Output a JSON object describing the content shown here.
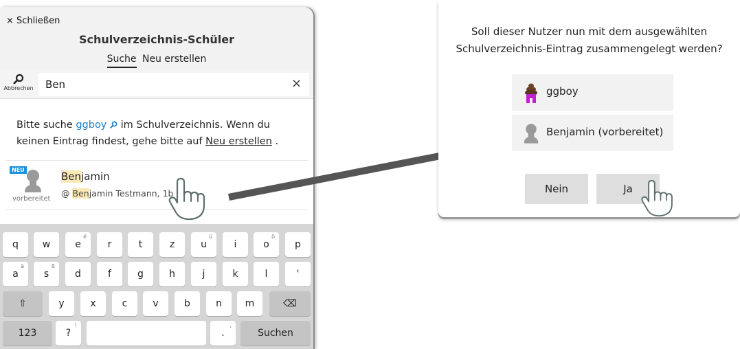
{
  "left_panel": {
    "close_label": "× Schließen",
    "title": "Schulverzeichnis-Schüler",
    "tabs": [
      {
        "label": "Suche",
        "active": true
      },
      {
        "label": "Neu erstellen",
        "active": false
      }
    ],
    "search": {
      "button_label": "Abbrechen",
      "value": "Ben",
      "clear_label": "×"
    },
    "info": {
      "part1": "Bitte suche ",
      "user": "ggboy",
      "part2": " im Schulverzeichnis. Wenn du keinen Eintrag findest, gehe bitte auf ",
      "link": "Neu erstellen",
      "part3": " ."
    },
    "result": {
      "badge": "NEU",
      "status": "vorbereitet",
      "name_highlight": "Ben",
      "name_rest": "jamin",
      "sub_prefix": "@ ",
      "sub_highlight": "Ben",
      "sub_rest": "jamin Testmann, 1b"
    }
  },
  "keyboard": {
    "row1": [
      "q",
      "w",
      "e",
      "r",
      "t",
      "z",
      "u",
      "i",
      "o",
      "p"
    ],
    "row2": [
      "a",
      "s",
      "d",
      "f",
      "g",
      "h",
      "j",
      "k",
      "l",
      "'"
    ],
    "row3": [
      "y",
      "x",
      "c",
      "v",
      "b",
      "n",
      "m"
    ],
    "shift": "⇧",
    "backspace": "⌫",
    "numbers": "123",
    "question": "?",
    "period": ".",
    "search": "Suchen",
    "super": {
      "e": "é",
      "u": "ü",
      "o": "ö",
      "a": "ä",
      "s": "ß",
      "question": "!",
      "period": ","
    }
  },
  "dialog": {
    "question_line1": "Soll dieser Nutzer nun mit dem ausgewählten",
    "question_line2": "Schulverzeichnis-Eintrag zusammengelegt werden?",
    "options": [
      {
        "label": "ggboy",
        "icon": "poop-avatar-icon"
      },
      {
        "label": "Benjamin (vorbereitet)",
        "icon": "person-silhouette-icon"
      }
    ],
    "no_label": "Nein",
    "yes_label": "Ja"
  },
  "colors": {
    "link": "#1a7fc8",
    "highlight": "#fbe8b4",
    "badge": "#1a8fe0",
    "arrow": "#555555"
  }
}
